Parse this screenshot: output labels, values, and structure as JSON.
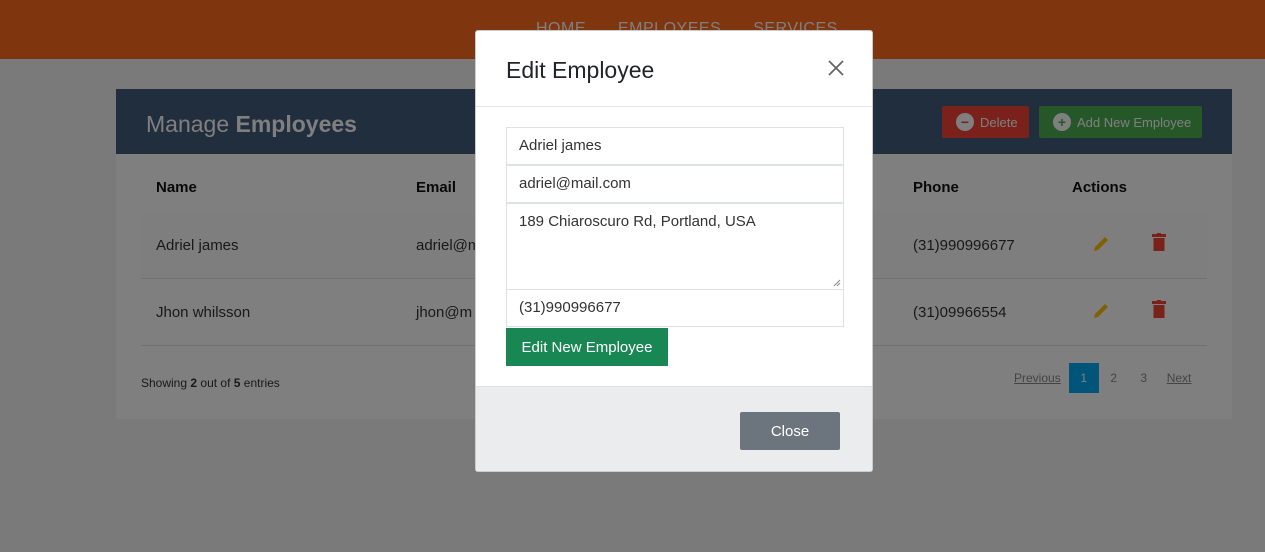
{
  "nav": {
    "links": [
      "HOME",
      "EMPLOYEES",
      "SERVICES"
    ]
  },
  "header": {
    "title_prefix": "Manage",
    "title_strong": "Employees",
    "delete_label": "Delete",
    "add_label": "Add New Employee"
  },
  "table": {
    "columns": [
      "Name",
      "Email",
      "Phone",
      "Actions"
    ],
    "rows": [
      {
        "name": "Adriel james",
        "email": "adriel@m",
        "phone": "(31)990996677"
      },
      {
        "name": "Jhon whilsson",
        "email": "jhon@m",
        "phone": "(31)09966554"
      }
    ]
  },
  "footer": {
    "showing": "Showing ",
    "shown": "2",
    "outof": " out of ",
    "total": "5",
    "entries": " entries",
    "pagination": {
      "prev": "Previous",
      "pages": [
        "1",
        "2",
        "3"
      ],
      "active": "1",
      "next": "Next"
    }
  },
  "modal": {
    "title": "Edit Employee",
    "fields": {
      "name": "Adriel james",
      "email": "adriel@mail.com",
      "address": "189 Chiaroscuro Rd, Portland, USA",
      "phone": "(31)990996677"
    },
    "submit_label": "Edit New Employee",
    "close_label": "Close"
  },
  "colors": {
    "nav": "#ff6a1a",
    "header": "#435d7d",
    "danger": "#f44336",
    "success": "#4caf50",
    "warning": "#ffc107",
    "primary_page": "#03a9f4",
    "submit": "#198754",
    "secondary": "#6c757d"
  },
  "icons": {
    "delete": "minus-circle-icon",
    "add": "plus-circle-icon",
    "edit": "pencil-icon",
    "remove": "trash-icon",
    "modal_close": "close-icon"
  }
}
